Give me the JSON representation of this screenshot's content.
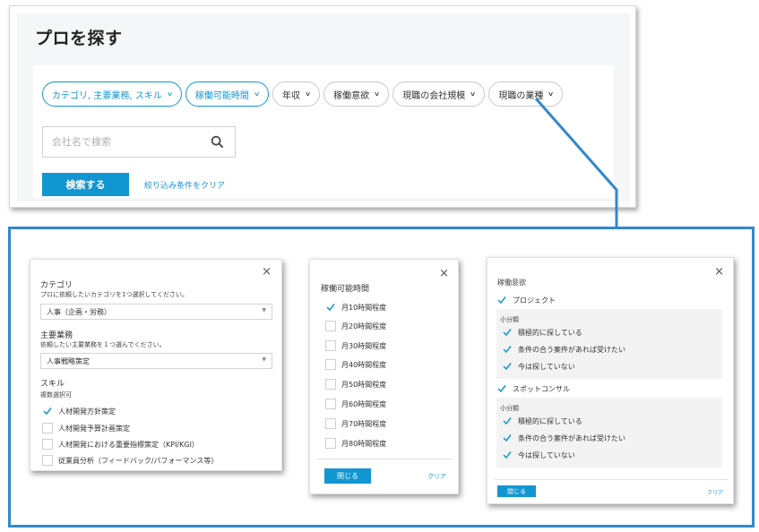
{
  "page": {
    "title": "プロを探す",
    "chips": [
      {
        "label": "カテゴリ, 主要業務, スキル",
        "active": true
      },
      {
        "label": "稼働可能時間",
        "active": true
      },
      {
        "label": "年収",
        "active": false
      },
      {
        "label": "稼働意欲",
        "active": false
      },
      {
        "label": "現職の会社規模",
        "active": false
      },
      {
        "label": "現職の業種",
        "active": false
      }
    ],
    "search": {
      "placeholder": "会社名で検索",
      "value": ""
    },
    "search_button": "検索する",
    "clear_link": "絞り込み条件をクリア"
  },
  "category_panel": {
    "close": "×",
    "category_title": "カテゴリ",
    "category_note": "プロに依頼したいカテゴリを1つ選択してください。",
    "category_value": "人事（企画・労務）",
    "work_title": "主要業務",
    "work_note": "依頼したい主要業務を１つ選んでください。",
    "work_value": "人事戦略策定",
    "skill_title": "スキル",
    "skill_note": "複数選択可",
    "skills": [
      {
        "label": "人材開発方針策定",
        "checked": true
      },
      {
        "label": "人材開発予算計画策定",
        "checked": false
      },
      {
        "label": "人材開発における重要指標策定（KPI/KGI）",
        "checked": false
      },
      {
        "label": "従業員分析（フィードバック/パフォーマンス等）",
        "checked": false
      }
    ]
  },
  "hours_panel": {
    "close": "×",
    "title": "稼働可能時間",
    "options": [
      {
        "label": "月10時間程度",
        "checked": true
      },
      {
        "label": "月20時間程度",
        "checked": false
      },
      {
        "label": "月30時間程度",
        "checked": false
      },
      {
        "label": "月40時間程度",
        "checked": false
      },
      {
        "label": "月50時間程度",
        "checked": false
      },
      {
        "label": "月60時間程度",
        "checked": false
      },
      {
        "label": "月70時間程度",
        "checked": false
      },
      {
        "label": "月80時間程度",
        "checked": false
      }
    ],
    "close_button": "閉じる",
    "clear": "クリア"
  },
  "motivation_panel": {
    "close": "×",
    "title": "稼働意欲",
    "groups": [
      {
        "label": "プロジェクト",
        "sub_title": "小分類",
        "items": [
          "積極的に探している",
          "条件の合う案件があれば受けたい",
          "今は探していない"
        ]
      },
      {
        "label": "スポットコンサル",
        "sub_title": "小分類",
        "items": [
          "積極的に探している",
          "条件の合う案件があれば受けたい",
          "今は探していない"
        ]
      }
    ],
    "close_button": "閉じる",
    "clear": "クリア"
  },
  "colors": {
    "accent": "#1296d2",
    "frame": "#3388cc"
  }
}
